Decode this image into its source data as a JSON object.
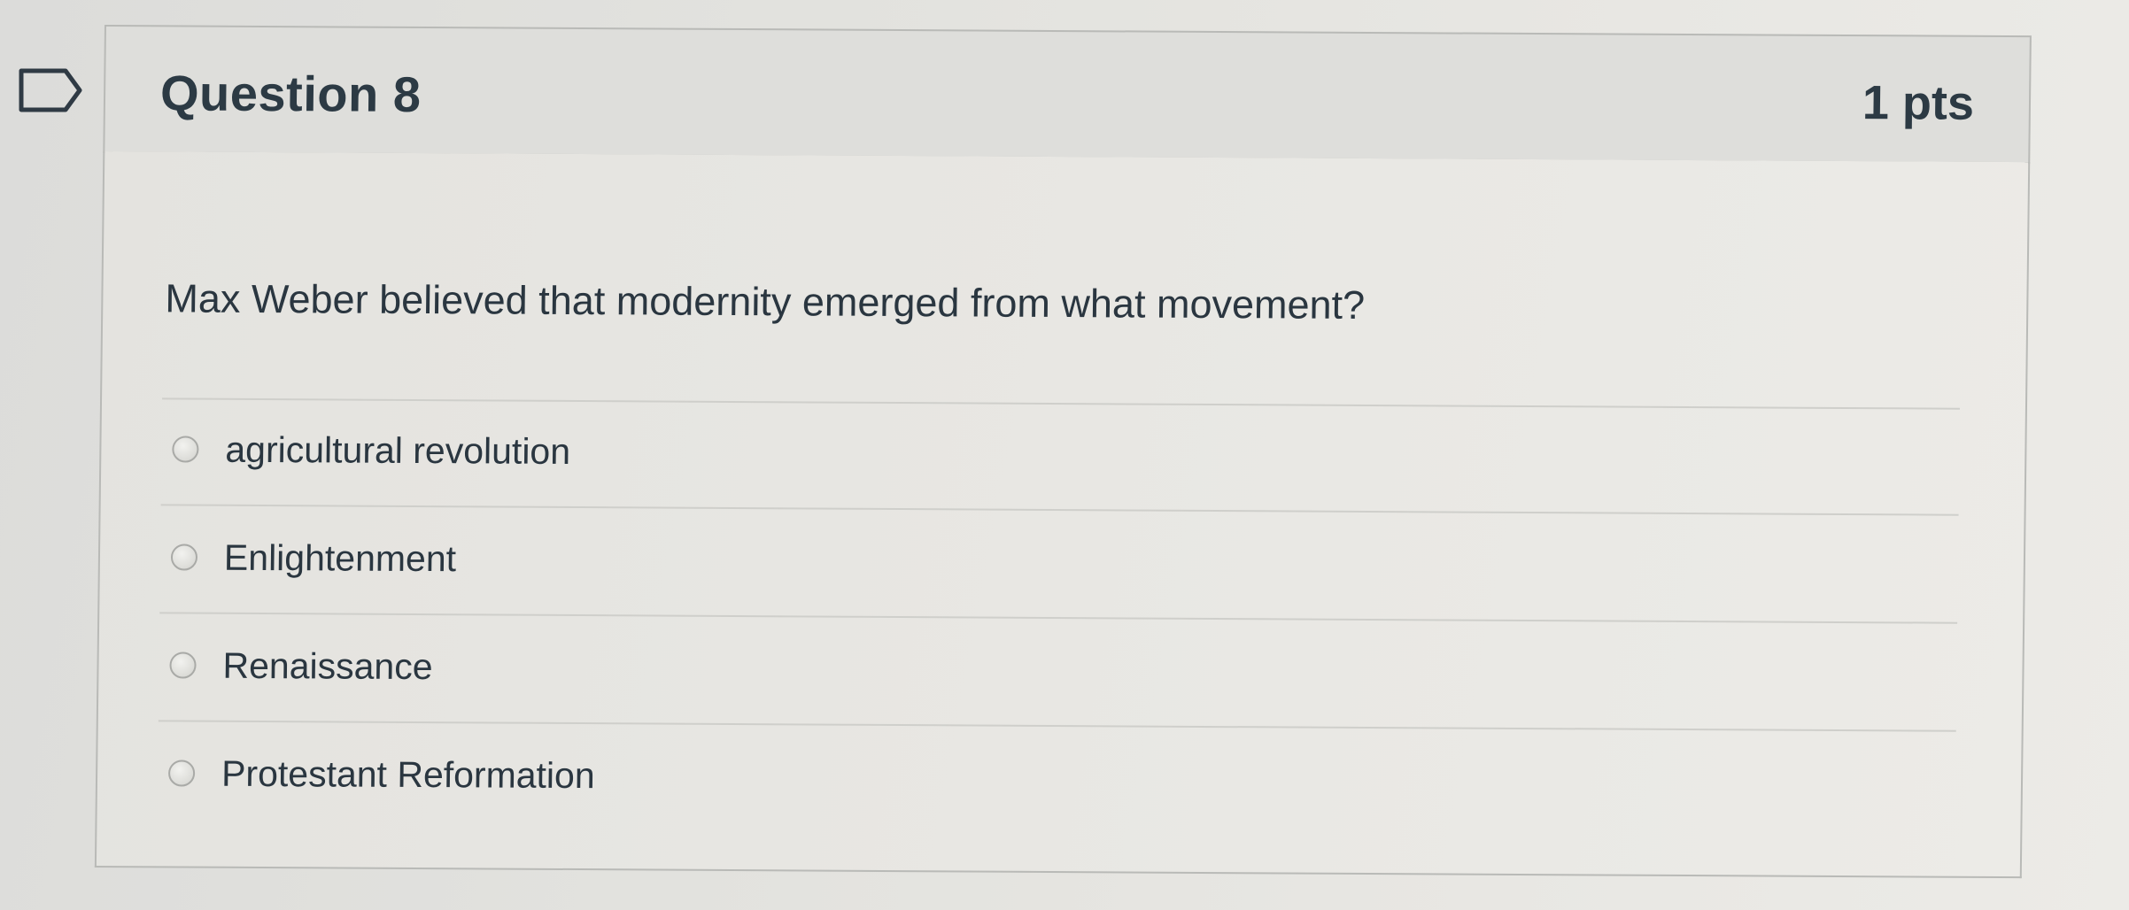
{
  "question": {
    "title": "Question 8",
    "points": "1 pts",
    "text": "Max Weber believed that modernity emerged from what movement?",
    "answers": [
      {
        "label": "agricultural revolution"
      },
      {
        "label": "Enlightenment"
      },
      {
        "label": "Renaissance"
      },
      {
        "label": "Protestant Reformation"
      }
    ]
  },
  "icons": {
    "flag": "bookmark-flag-icon",
    "radio": "radio-button-icon"
  },
  "colors": {
    "header_background": "#dededb",
    "border": "#b9bab7",
    "text": "#2c3a44"
  }
}
